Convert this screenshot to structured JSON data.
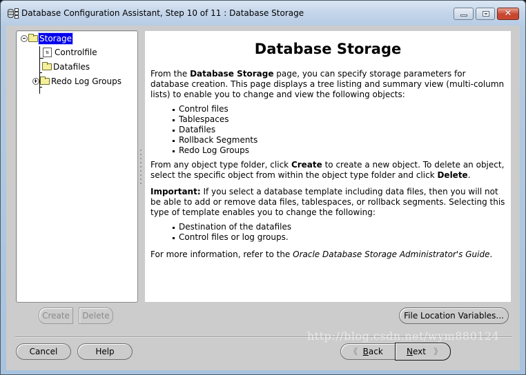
{
  "window": {
    "title": "Database Configuration Assistant, Step 10 of 11 : Database Storage",
    "controls": {
      "minimize": "minimize",
      "maximize": "maximize",
      "close": "✕"
    }
  },
  "tree": {
    "root": {
      "label": "Storage",
      "expanded": true,
      "selected": true
    },
    "children": [
      {
        "label": "Controlfile",
        "icon": "document-icon"
      },
      {
        "label": "Datafiles",
        "icon": "folder-icon"
      },
      {
        "label": "Redo Log Groups",
        "icon": "folder-icon",
        "expandable": true
      }
    ]
  },
  "content": {
    "heading": "Database Storage",
    "p1_pre": "From the ",
    "p1_bold": "Database Storage",
    "p1_post": " page, you can specify storage parameters for database creation. This page displays a tree listing and summary view (multi-column lists) to enable you to change and view the following objects:",
    "list1": [
      "Control files",
      "Tablespaces",
      "Datafiles",
      "Rollback Segments",
      "Redo Log Groups"
    ],
    "p2_a": "From any object type folder, click ",
    "p2_create": "Create",
    "p2_b": " to create a new object. To delete an object, select the specific object from within the object type folder and click ",
    "p2_delete": "Delete",
    "p2_c": ".",
    "p3_bold": "Important:",
    "p3_text": " If you select a database template including data files, then you will not be able to add or remove data files, tablespaces, or rollback segments. Selecting this type of template enables you to change the following:",
    "list2": [
      "Destination of the datafiles",
      "Control files or log groups."
    ],
    "p4_pre": "For more information, refer to the ",
    "p4_italic": "Oracle Database Storage Administrator's Guide",
    "p4_post": "."
  },
  "buttons": {
    "create": "Create",
    "delete": "Delete",
    "file_location": "File Location Variables...",
    "cancel": "Cancel",
    "help": "Help",
    "back_chevron": "《",
    "back_mnemonic": "B",
    "back_rest": "ack",
    "next_mnemonic": "N",
    "next_rest": "ext",
    "next_chevron": "》"
  },
  "watermark": "http://blog.csdn.net/wym880124"
}
